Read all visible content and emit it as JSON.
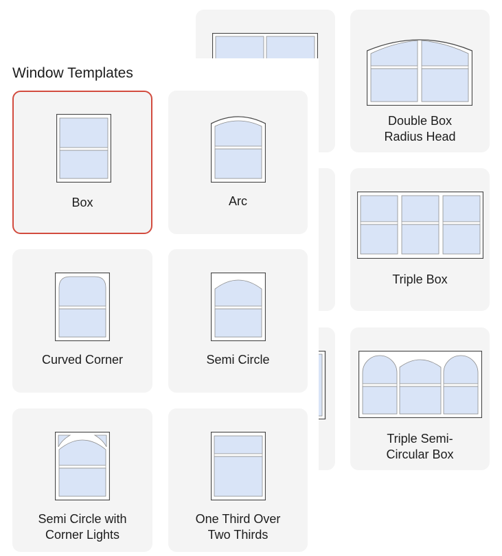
{
  "panel": {
    "title": "Window Templates"
  },
  "templates": [
    {
      "label_lines": [
        "Box"
      ],
      "icon": "box-window-icon",
      "selected": true
    },
    {
      "label_lines": [
        "Arc"
      ],
      "icon": "arc-window-icon",
      "selected": false
    },
    {
      "label_lines": [
        "Curved Corner"
      ],
      "icon": "curved-corner-window-icon",
      "selected": false
    },
    {
      "label_lines": [
        "Semi Circle"
      ],
      "icon": "semi-circle-window-icon",
      "selected": false
    },
    {
      "label_lines": [
        "Semi Circle with",
        "Corner Lights"
      ],
      "icon": "semi-circle-corner-lights-window-icon",
      "selected": false
    },
    {
      "label_lines": [
        "One Third Over",
        "Two Thirds"
      ],
      "icon": "one-third-over-two-thirds-window-icon",
      "selected": false
    }
  ],
  "background_templates": [
    {
      "label_lines": [
        "Double Box",
        "Radius Head"
      ],
      "icon": "double-box-radius-head-window-icon"
    },
    {
      "label_lines": [
        "Triple Box"
      ],
      "icon": "triple-box-window-icon"
    },
    {
      "label_lines": [
        "Triple Semi-",
        "Circular Box"
      ],
      "icon": "triple-semi-circular-box-window-icon"
    }
  ],
  "colors": {
    "selected_border": "#d24b3e",
    "card_bg": "#f4f4f4",
    "glass": "#d9e4f7"
  }
}
